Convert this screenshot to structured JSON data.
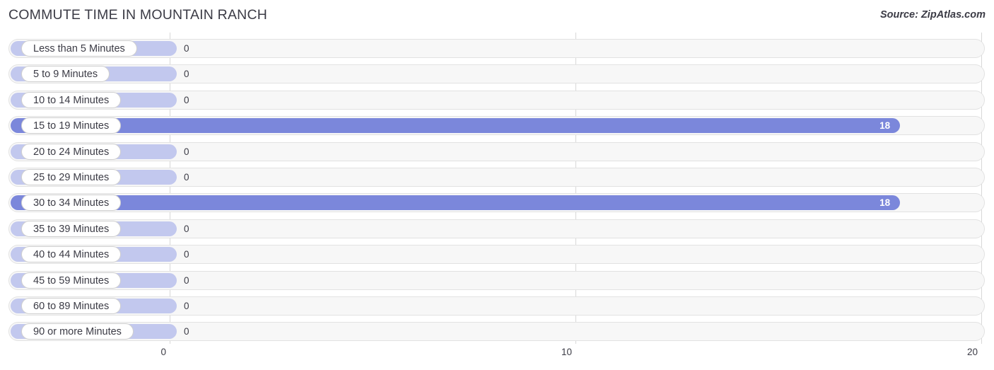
{
  "header": {
    "title": "COMMUTE TIME IN MOUNTAIN RANCH",
    "source": "Source: ZipAtlas.com"
  },
  "colors": {
    "bar_positive": "#7b87db",
    "bar_zero": "#c2c8ee",
    "track": "#f7f7f7",
    "track_border": "#e2e2e2",
    "gridline": "#d8d8d8",
    "text": "#3b3b45"
  },
  "chart_data": {
    "type": "bar",
    "orientation": "horizontal",
    "title": "COMMUTE TIME IN MOUNTAIN RANCH",
    "xlabel": "",
    "ylabel": "",
    "xlim": [
      0,
      20
    ],
    "xticks": [
      0,
      10,
      20
    ],
    "xtick_labels": [
      "0",
      "10",
      "20"
    ],
    "grid": true,
    "legend": null,
    "categories": [
      "Less than 5 Minutes",
      "5 to 9 Minutes",
      "10 to 14 Minutes",
      "15 to 19 Minutes",
      "20 to 24 Minutes",
      "25 to 29 Minutes",
      "30 to 34 Minutes",
      "35 to 39 Minutes",
      "40 to 44 Minutes",
      "45 to 59 Minutes",
      "60 to 89 Minutes",
      "90 or more Minutes"
    ],
    "values": [
      0,
      0,
      0,
      18,
      0,
      0,
      18,
      0,
      0,
      0,
      0,
      0
    ],
    "value_labels": [
      "0",
      "0",
      "0",
      "18",
      "0",
      "0",
      "18",
      "0",
      "0",
      "0",
      "0",
      "0"
    ]
  }
}
